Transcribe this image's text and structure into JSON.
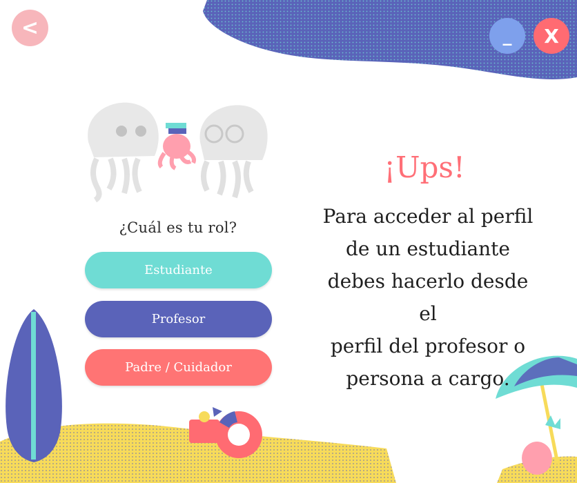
{
  "window": {
    "back_label": "<",
    "minimize_label": "_",
    "close_label": "X"
  },
  "role_select": {
    "question": "¿Cuál es tu rol?",
    "buttons": [
      "Estudiante",
      "Profesor",
      "Padre / Cuidador"
    ]
  },
  "alert": {
    "title": "¡Ups!",
    "message_lines": [
      "Para acceder al perfil",
      "de un estudiante",
      "debes hacerlo desde el",
      "perfil del profesor o",
      "persona a cargo."
    ]
  },
  "colors": {
    "student": "#6fdcd4",
    "teacher": "#5a63b9",
    "parent": "#ff7474",
    "accent_pink": "#ff6f77",
    "sand": "#f7db5a",
    "wave": "#5a63b9"
  },
  "icons": [
    "jellyfish-icon",
    "octopus-icon",
    "surfboard-icon",
    "beach-umbrella-icon",
    "pineapple-icon",
    "bucket-icon",
    "float-ring-icon"
  ]
}
